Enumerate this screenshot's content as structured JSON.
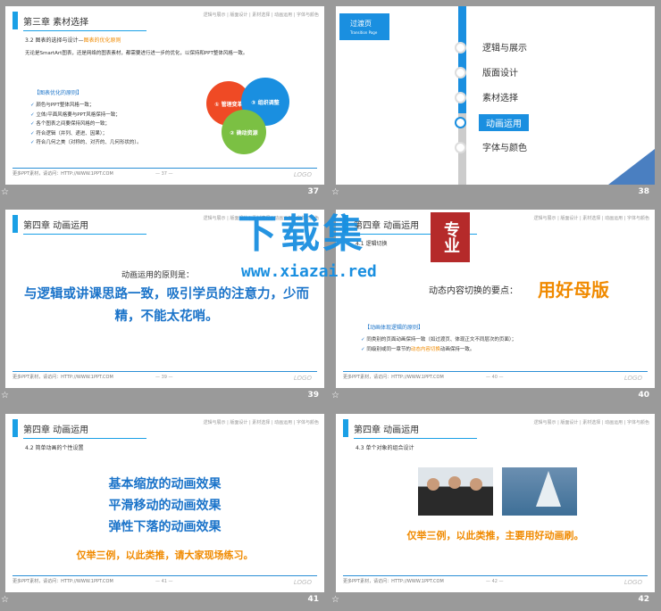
{
  "common": {
    "footer_text": "更多PPT素材，请访问：HTTP://WWW.1PPT.COM",
    "nav_text": "逻辑与展示 | 版面设计 | 素材选择 | 动画运用 | 字体与颜色",
    "logo": "LOGO",
    "star": "☆"
  },
  "slides": [
    {
      "number": "37",
      "chapter": "第三章  素材选择",
      "sub_prefix": "3.2 图表的选择与设计—",
      "sub_highlight": "图表的优化原则",
      "intro": "无论是SmartArt图表，还是网络的图表素材，都需要进行进一步的优化，以保持和PPT整体风格一致。",
      "principles_title": "【图表优化的原则】",
      "bullets": [
        "颜色与PPT整体风格一致；",
        "立体/平面风格要与PPT风格保持一致；",
        "各个图表之间要保持风格的一致；",
        "符合逻辑（并列、递进、因果）；",
        "符合几何之美（对称的、对齐的、几何形状的）。"
      ],
      "circles": [
        "① 管理变革",
        "③ 组织调整",
        "② 确动资源"
      ],
      "footer_page": "— 37 —"
    },
    {
      "number": "38",
      "transition_title": "过渡页",
      "transition_sub": "Transition Page",
      "items": [
        "逻辑与展示",
        "版面设计",
        "素材选择",
        "动画运用",
        "字体与颜色"
      ],
      "active_index": 3
    },
    {
      "number": "39",
      "chapter": "第四章  动画运用",
      "lead": "动画运用的原则是：",
      "main_text": "与逻辑或讲课思路一致，吸引学员的注意力，少而精，不能太花哨。",
      "footer_page": "— 39 —"
    },
    {
      "number": "40",
      "chapter": "第四章  动画运用",
      "sub": "4.1 逻辑切换",
      "lead": "动态内容切换的要点：",
      "highlight": "用好母版",
      "title": "【动画体现逻辑的原则】",
      "bullets": [
        "同类别的页面动画保持一致（如过渡页、体现正文不同层次的页面）；",
        "同级别或同一章节的动态内容切换动画保持一致。"
      ],
      "bullet2_prefix": "同级别或同一章节的",
      "bullet2_highlight": "动态内容切换",
      "bullet2_suffix": "动画保持一致。",
      "footer_page": "— 40 —"
    },
    {
      "number": "41",
      "chapter": "第四章  动画运用",
      "sub": "4.2 简单动画的个性设置",
      "lines": [
        "基本缩放的动画效果",
        "平滑移动的动画效果",
        "弹性下落的动画效果"
      ],
      "note": "仅举三例，以此类推，请大家现场练习。",
      "footer_page": "— 41 —"
    },
    {
      "number": "42",
      "chapter": "第四章  动画运用",
      "sub": "4.3 单个对象的组合设计",
      "note": "仅举三例，以此类推，主要用好动画刷。",
      "footer_page": "— 42 —"
    }
  ],
  "watermark": {
    "title": "下载集",
    "seal": "专业",
    "url": "www.xiazai.red"
  }
}
